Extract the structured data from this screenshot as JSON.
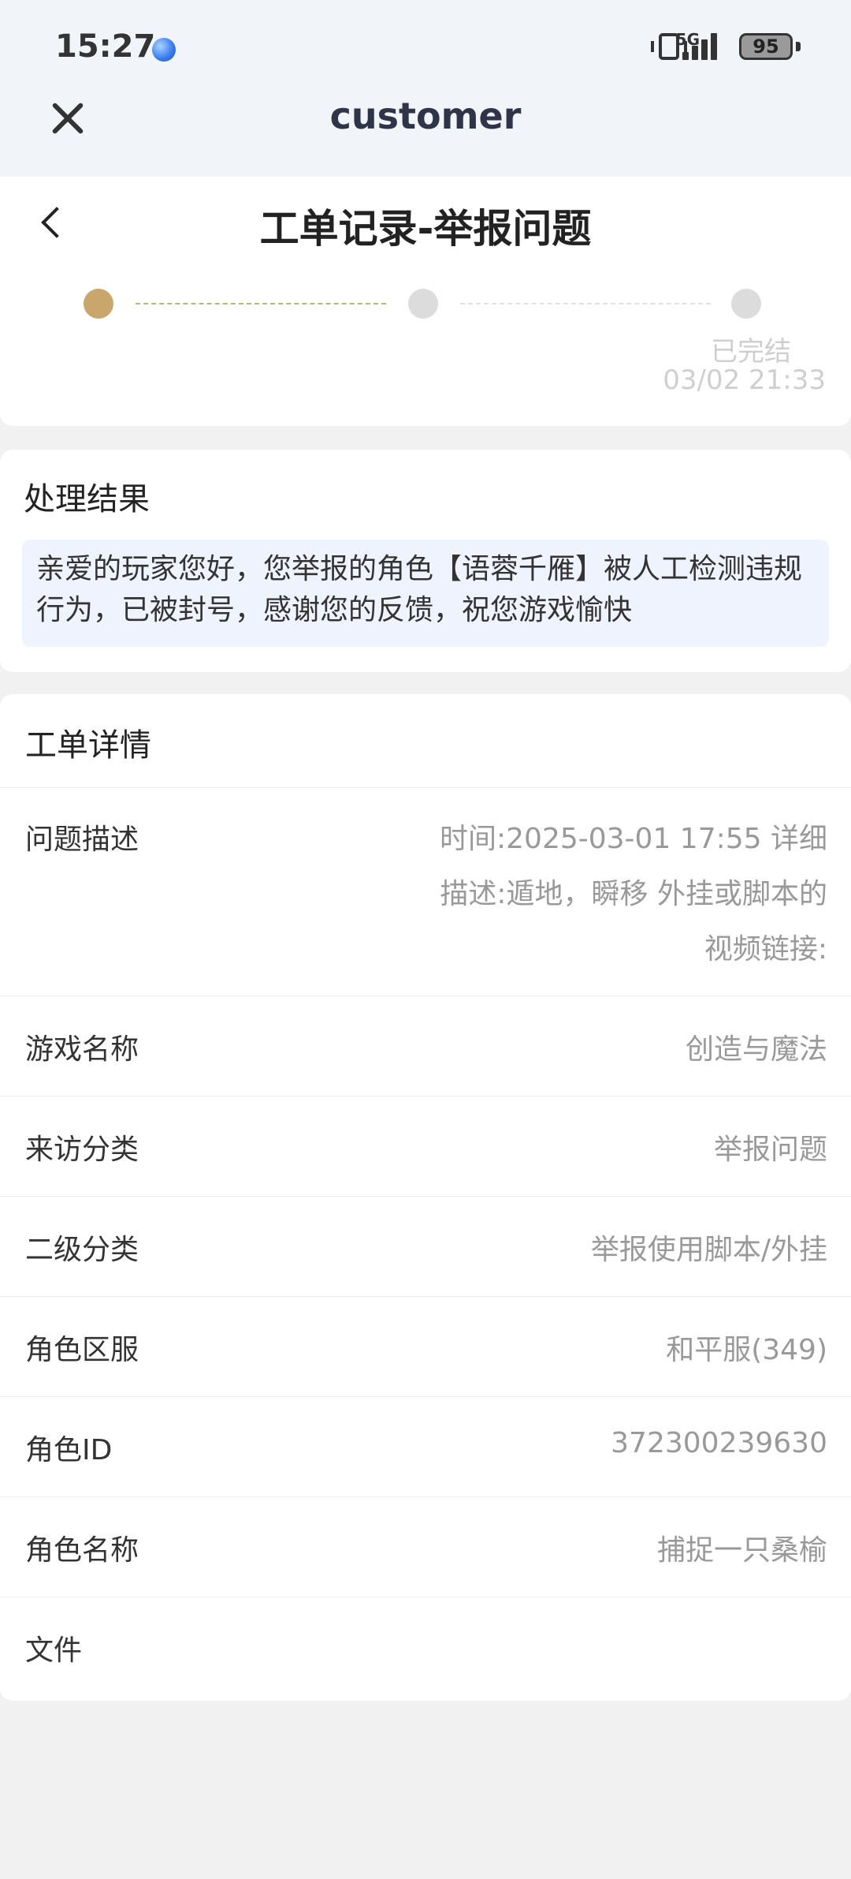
{
  "status_bar": {
    "time": "15:27",
    "network": "5G",
    "battery": "95"
  },
  "webview": {
    "title": "customer"
  },
  "page": {
    "title": "工单记录-举报问题"
  },
  "progress": {
    "status": "已完结",
    "time": "03/02 21:33"
  },
  "result": {
    "title": "处理结果",
    "text": "亲爱的玩家您好，您举报的角色【语蓉千雁】被人工检测违规行为，已被封号，感谢您的反馈，祝您游戏愉快"
  },
  "details": {
    "title": "工单详情",
    "description": {
      "label": "问题描述",
      "value": "时间:2025-03-01 17:55 详细描述:遁地，瞬移 外挂或脚本的视频链接:"
    },
    "rows": [
      {
        "label": "游戏名称",
        "value": "创造与魔法"
      },
      {
        "label": "来访分类",
        "value": "举报问题"
      },
      {
        "label": "二级分类",
        "value": "举报使用脚本/外挂"
      },
      {
        "label": "角色区服",
        "value": "和平服(349)"
      },
      {
        "label": "角色ID",
        "value": "372300239630"
      },
      {
        "label": "角色名称",
        "value": "捕捉一只桑榆"
      },
      {
        "label": "文件",
        "value": ""
      }
    ]
  },
  "colors": {
    "accent_step": "#c9a66b",
    "inactive_step": "#dcdcdc",
    "result_bg": "#eef3fd",
    "header_bg": "#f1f4f9",
    "page_bg": "#f1f1f1"
  },
  "icons": [
    "close-icon",
    "back-arrow-icon",
    "vibrate-icon",
    "signal-icon",
    "battery-icon",
    "browser-icon"
  ]
}
